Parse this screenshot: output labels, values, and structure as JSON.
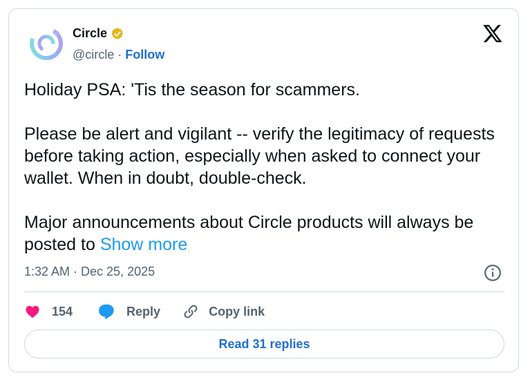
{
  "author": {
    "name": "Circle",
    "handle": "@circle",
    "separator": "·",
    "follow_label": "Follow",
    "verified_color": "#e2b719"
  },
  "tweet": {
    "text": "Holiday PSA: 'Tis the season for scammers.\n\nPlease be alert and vigilant -- verify the legitimacy of requests before taking action, especially when asked to connect your wallet. When in doubt, double-check.\n\nMajor announcements about Circle products will always be posted to ",
    "show_more_label": "Show more",
    "timestamp": "1:32 AM · Dec 25, 2025"
  },
  "actions": {
    "like_count": "154",
    "reply_label": "Reply",
    "copy_link_label": "Copy link"
  },
  "read_replies_label": "Read 31 replies",
  "colors": {
    "like": "#f91880",
    "reply": "#1d9bf0",
    "link": "#1d6fd8",
    "muted": "#536471"
  },
  "icons": [
    "circle-logo-icon",
    "verified-badge-icon",
    "x-logo-icon",
    "info-icon",
    "heart-icon",
    "reply-bubble-icon",
    "link-icon"
  ]
}
